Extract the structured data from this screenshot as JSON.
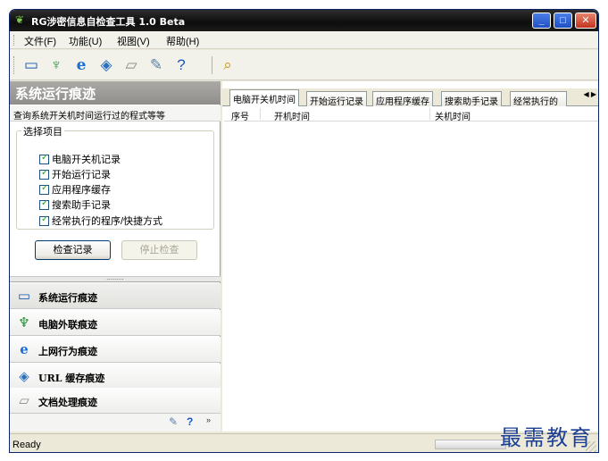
{
  "window": {
    "title": "RG涉密信息自检查工具 1.0 Beta"
  },
  "menu": [
    "文件(F)",
    "功能(U)",
    "视图(V)",
    "帮助(H)"
  ],
  "toolbar": {
    "icons": [
      "computer-icon",
      "usb-device-icon",
      "ie-browser-icon",
      "url-cache-icon",
      "document-icon",
      "eraser-icon",
      "help-icon",
      "search-icon"
    ]
  },
  "left_panel": {
    "header": "系统运行痕迹",
    "description": "查询系统开关机时间运行过的程式等等",
    "group_label": "选择项目",
    "options": [
      {
        "label": "电脑开关机记录",
        "checked": true
      },
      {
        "label": "开始运行记录",
        "checked": true
      },
      {
        "label": "应用程序缓存",
        "checked": true
      },
      {
        "label": "搜索助手记录",
        "checked": true
      },
      {
        "label": "经常执行的程序/快捷方式",
        "checked": true
      }
    ],
    "check_button": "检查记录",
    "stop_button": "停止检查",
    "splitter_dots": "..........",
    "nav": [
      {
        "label": "系统运行痕迹",
        "icon": "computer-icon"
      },
      {
        "label": "电脑外联痕迹",
        "icon": "usb-device-icon"
      },
      {
        "label": "上网行为痕迹",
        "icon": "ie-browser-icon"
      },
      {
        "label": "URL 缓存痕迹",
        "icon": "url-cache-icon"
      },
      {
        "label": "文档处理痕迹",
        "icon": "document-icon"
      }
    ]
  },
  "tabs": [
    "电脑开关机时间",
    "开始运行记录",
    "应用程序缓存",
    "搜索助手记录",
    "经常执行的"
  ],
  "list": {
    "columns": [
      "序号",
      "开机时间",
      "关机时间"
    ],
    "rows": []
  },
  "status": {
    "text": "Ready"
  },
  "watermark": "最需教育"
}
